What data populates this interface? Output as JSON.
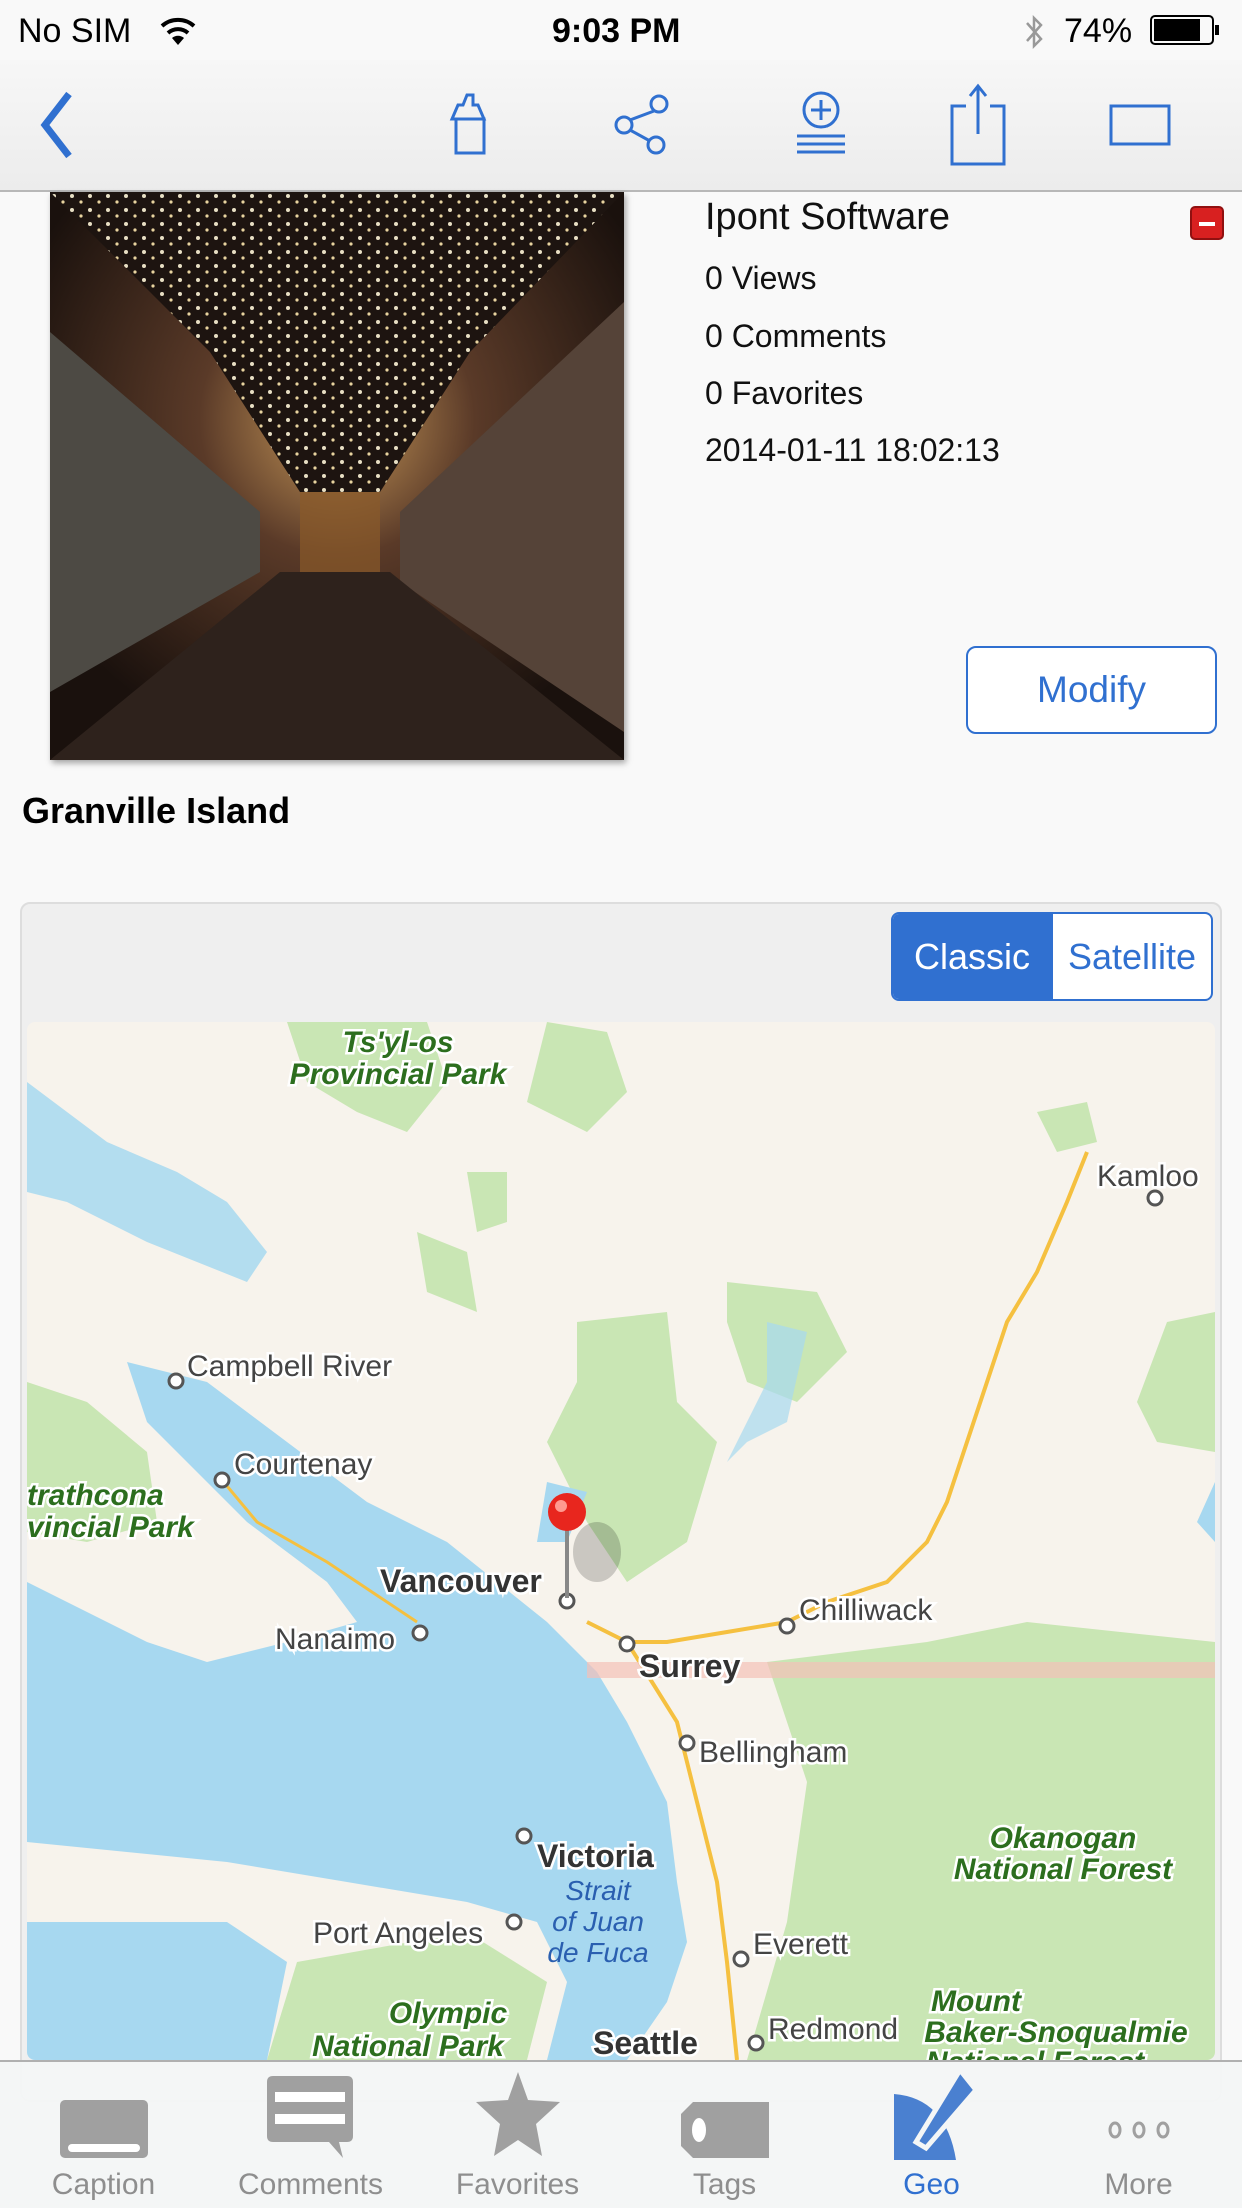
{
  "status_bar": {
    "carrier": "No SIM",
    "time": "9:03 PM",
    "battery": "74%"
  },
  "nav_bar": {
    "icons": [
      "back-chevron",
      "home",
      "share-network",
      "add-to-list",
      "export",
      "fullscreen-rectangle"
    ]
  },
  "photo": {
    "author": "Ipont Software",
    "views": "0 Views",
    "comments": "0 Comments",
    "favorites": "0 Favorites",
    "date": "2014-01-11 18:02:13",
    "modify_label": "Modify",
    "caption": "Granville Island"
  },
  "map": {
    "segments": {
      "classic": "Classic",
      "satellite": "Satellite",
      "selected": "Classic"
    },
    "labels": {
      "tsylos1": "Ts'yl-os",
      "tsylos2": "Provincial Park",
      "kamloops": "Kamloo",
      "campbell": "Campbell River",
      "courtenay": "Courtenay",
      "strath1": "trathcona",
      "strath2": "vincial Park",
      "vancouver": "Vancouver",
      "nanaimo": "Nanaimo",
      "chilliwack": "Chilliwack",
      "surrey": "Surrey",
      "bellingham": "Bellingham",
      "okan1": "Okanogan",
      "okan2": "National Forest",
      "victoria": "Victoria",
      "strait1": "Strait",
      "strait2": "of Juan",
      "strait3": "de Fuca",
      "portangeles": "Port Angeles",
      "everett": "Everett",
      "olympic1": "Olympic",
      "olympic2": "National Park",
      "seattle": "Seattle",
      "redmond": "Redmond",
      "baker1": "Mount",
      "baker2": "Baker-Snoqualmie",
      "baker3": "National Forest"
    },
    "colors": {
      "land": "#f7f3ec",
      "water": "#a7d8f0",
      "park": "#c9e6b4",
      "road": "#f5c040",
      "pin": "#e8261e"
    }
  },
  "tab_bar": {
    "items": [
      {
        "label": "Caption"
      },
      {
        "label": "Comments"
      },
      {
        "label": "Favorites"
      },
      {
        "label": "Tags"
      },
      {
        "label": "Geo",
        "active": true
      },
      {
        "label": "More"
      }
    ]
  },
  "accent": "#3070d0"
}
